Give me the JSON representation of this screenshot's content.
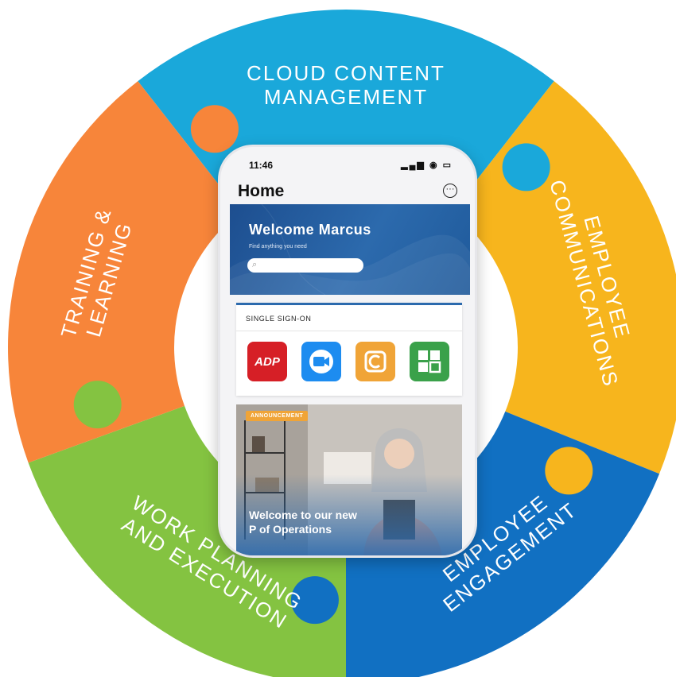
{
  "segments": [
    {
      "id": "cloud",
      "lines": [
        "CLOUD CONTENT",
        "MANAGEMENT"
      ],
      "color": "#1aa8da"
    },
    {
      "id": "comms",
      "lines": [
        "EMPLOYEE",
        "COMMUNICATIONS"
      ],
      "color": "#f7b51d"
    },
    {
      "id": "engage",
      "lines": [
        "EMPLOYEE",
        "ENGAGEMENT"
      ],
      "color": "#1170c2"
    },
    {
      "id": "work",
      "lines": [
        "WORK PLANNING",
        "AND EXECUTION"
      ],
      "color": "#84c341"
    },
    {
      "id": "training",
      "lines": [
        "TRAINING &",
        "LEARNING"
      ],
      "color": "#f7853a"
    }
  ],
  "phone": {
    "time": "11:46",
    "status_icons": "▂▄▆ ◉ ▭",
    "title": "Home",
    "more_icon": "···",
    "banner": {
      "welcome": "Welcome Marcus",
      "subtitle": "Find anything you need",
      "search_icon": "⌕"
    },
    "sso": {
      "label": "SINGLE SIGN-ON",
      "apps": [
        {
          "name": "adp-app-icon",
          "label": "ADP",
          "color": "#d61f26"
        },
        {
          "name": "zoom-app-icon",
          "label": "",
          "color": "#1d8cf0"
        },
        {
          "name": "c-app-icon",
          "label": "",
          "color": "#f0a437"
        },
        {
          "name": "grid-app-icon",
          "label": "",
          "color": "#3aa14a"
        }
      ]
    },
    "announcement": {
      "badge": "ANNOUNCEMENT",
      "title": "Welcome to our new",
      "title2": "P of Operations"
    }
  }
}
